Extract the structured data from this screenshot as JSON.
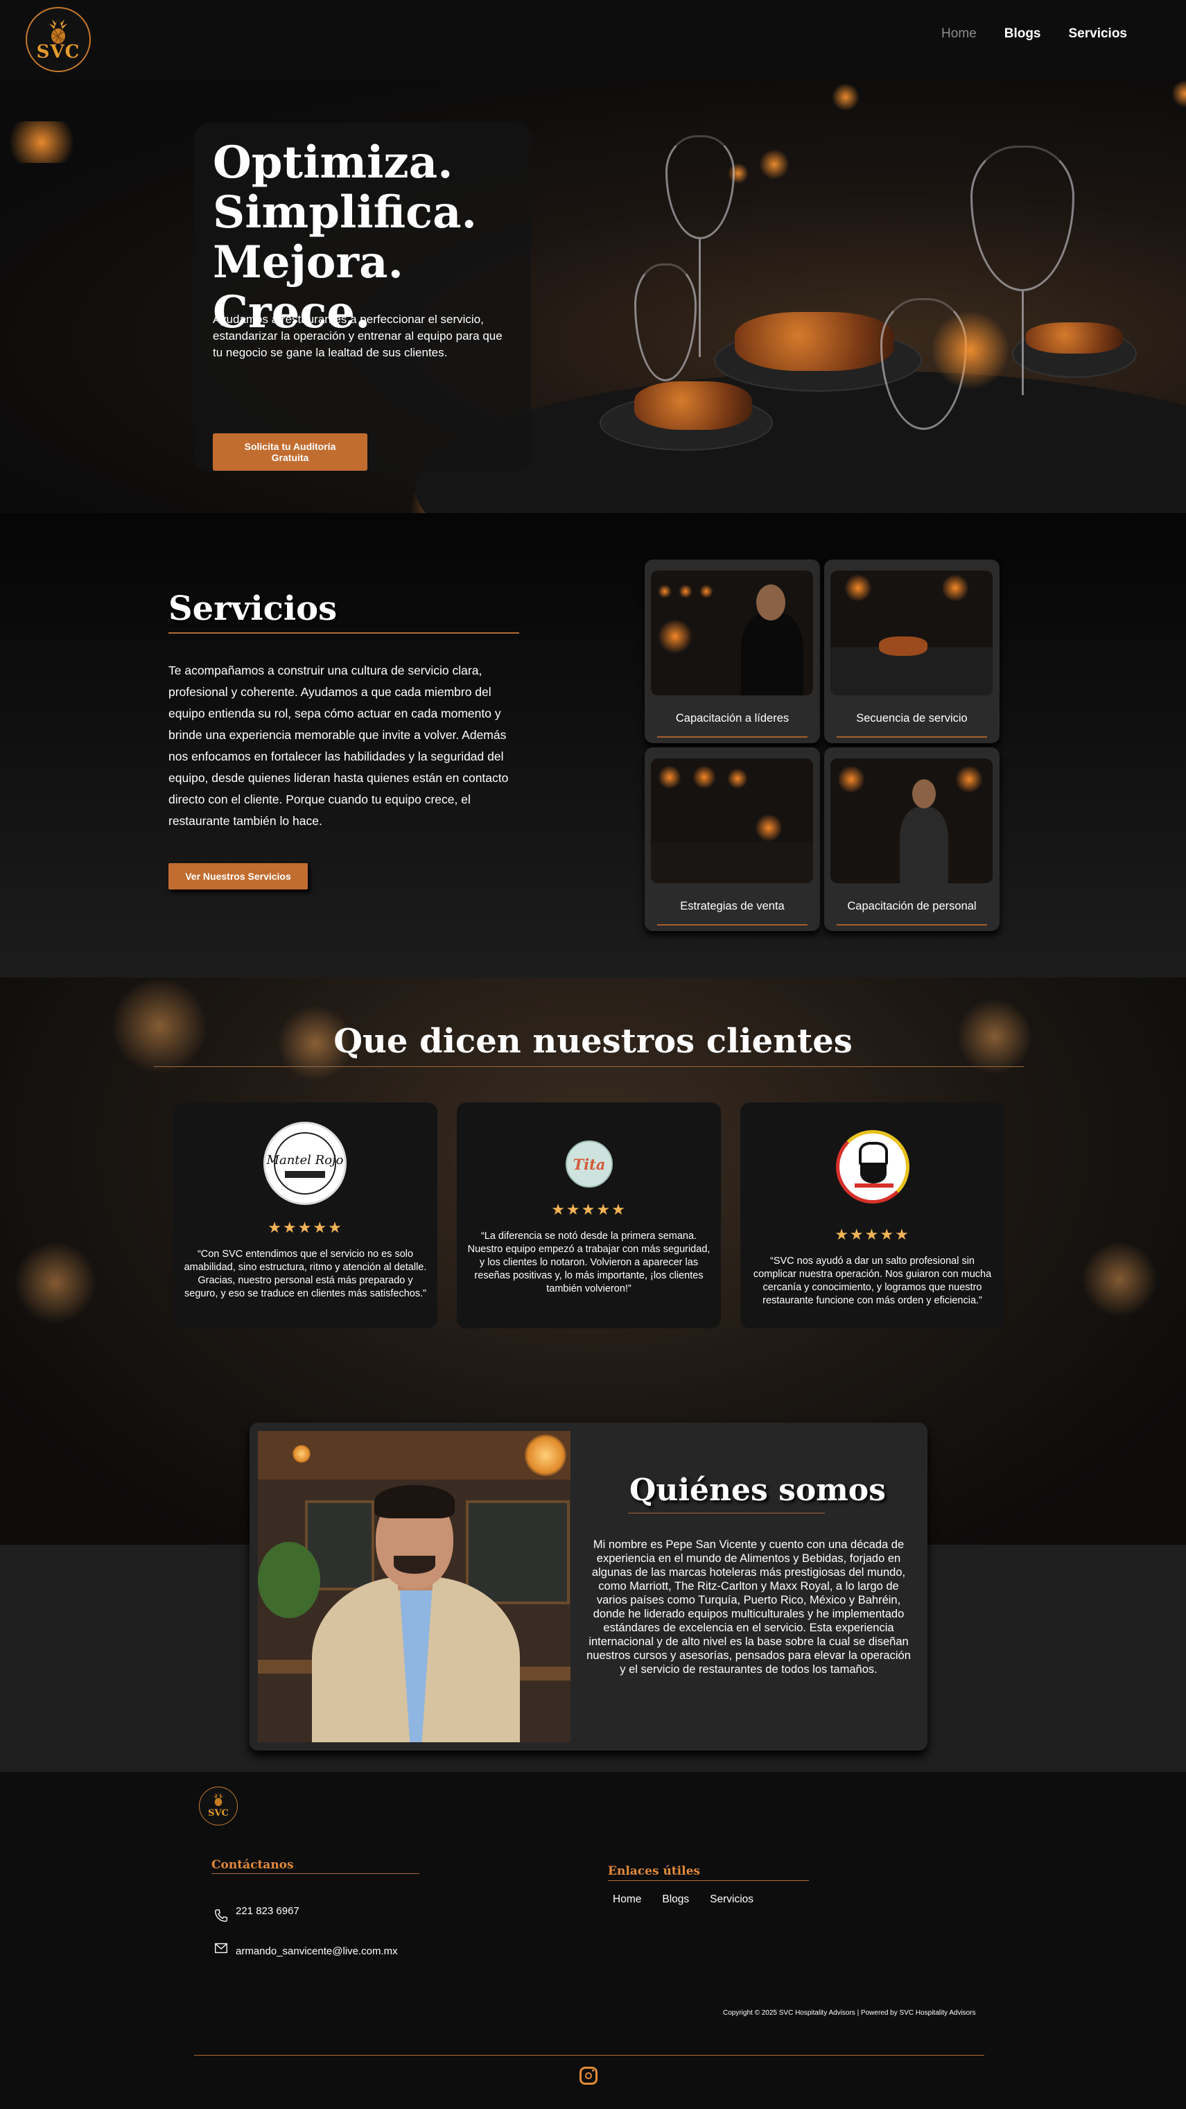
{
  "header": {
    "logo_text": "SVC",
    "nav": [
      "Home",
      "Blogs",
      "Servicios"
    ]
  },
  "hero": {
    "title_lines": [
      "Optimiza.",
      "Simplifica.",
      "Mejora. Crece."
    ],
    "text": "Ayudamos a restaurantes a perfeccionar el servicio, estandarizar la operación y entrenar al equipo para que tu negocio se gane la lealtad de sus clientes.",
    "button_lines": [
      "Solicita tu Auditoría",
      "Gratuita"
    ]
  },
  "services": {
    "title": "Servicios",
    "text": "Te acompañamos a construir una cultura de servicio clara, profesional y coherente. Ayudamos a que cada miembro del equipo entienda su rol, sepa cómo actuar en cada momento y brinde una experiencia memorable que invite a volver. Además nos enfocamos en fortalecer las habilidades y la seguridad del equipo, desde quienes lideran hasta quienes están en contacto directo con el cliente. Porque cuando tu equipo crece, el restaurante también lo hace.",
    "button": "Ver Nuestros Servicios",
    "cards": [
      {
        "label": "Capacitación a líderes",
        "image": "leader-photo"
      },
      {
        "label": "Secuencia de servicio",
        "image": "table-setting-photo"
      },
      {
        "label": "Estrategias de venta",
        "image": "wine-glass-photo"
      },
      {
        "label": "Capacitación de personal",
        "image": "waiter-photo"
      }
    ]
  },
  "testimonials": {
    "title": "Que dicen nuestros clientes",
    "items": [
      {
        "logo_text": "Mantel Rojo",
        "stars": "★★★★★",
        "quote": "“Con SVC entendimos que el servicio no es solo amabilidad, sino estructura, ritmo y atención al detalle. Gracias, nuestro personal está más preparado y seguro, y eso se traduce en clientes más satisfechos.”"
      },
      {
        "logo_text": "Tita",
        "stars": "★★★★★",
        "quote": "“La diferencia se notó desde la primera semana. Nuestro equipo empezó a trabajar con más seguridad, y los clientes lo notaron. Volvieron a aparecer las reseñas positivas y, lo más importante, ¡los clientes también volvieron!”"
      },
      {
        "logo_text": "",
        "stars": "★★★★★",
        "quote": "“SVC nos ayudó a dar un salto profesional sin complicar nuestra operación. Nos guiaron con mucha cercanía y conocimiento, y logramos que nuestro restaurante funcione con más orden y eficiencia.”"
      }
    ]
  },
  "about": {
    "title": "Quiénes somos",
    "text": "Mi nombre es Pepe San Vicente y cuento con una década de experiencia en el mundo de Alimentos y Bebidas, forjado en algunas de las marcas hoteleras más prestigiosas del mundo, como Marriott, The Ritz-Carlton y Maxx Royal, a lo largo de varios países como Turquía, Puerto Rico, México y Bahréin, donde he liderado equipos multiculturales y he implementado estándares de excelencia en el servicio. Esta experiencia internacional y de alto nivel es la base sobre la cual se diseñan nuestros cursos y asesorías, pensados para elevar la operación y el servicio de restaurantes de todos los tamaños."
  },
  "footer": {
    "logo_text": "SVC",
    "contact_heading": "Contáctanos",
    "phone": "221 823 6967",
    "email": "armando_sanvicente@live.com.mx",
    "links_heading": "Enlaces útiles",
    "links": [
      "Home",
      "Blogs",
      "Servicios"
    ],
    "copyright": "Copyright © 2025 SVC Hospitality Advisors | Powered by SVC Hospitality Advisors",
    "social_icon": "instagram-icon"
  },
  "colors": {
    "accent": "#c26d30",
    "gold": "#e39a2e",
    "star": "#f0b356"
  }
}
